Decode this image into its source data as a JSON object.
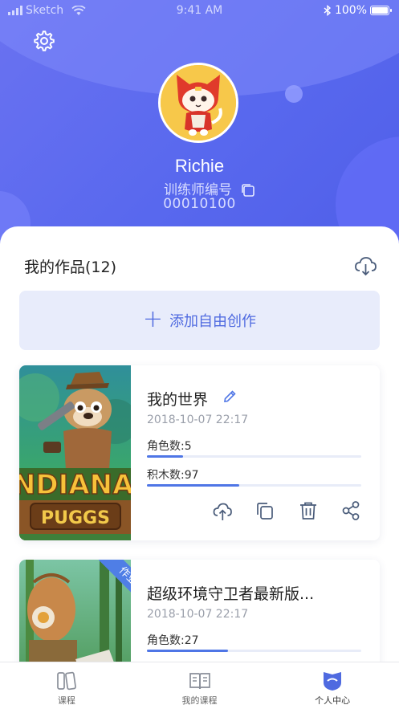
{
  "status_bar": {
    "carrier": "Sketch",
    "time": "9:41 AM",
    "battery": "100%"
  },
  "profile": {
    "username": "Richie",
    "trainer_label": "训练师编号",
    "trainer_id": "00010100"
  },
  "works": {
    "title": "我的作品(12)",
    "add_label": "添加自由创作",
    "items": [
      {
        "title": "我的世界",
        "date": "2018-10-07 22:17",
        "roles_label": "角色数:5",
        "roles_fill": 0.17,
        "blocks_label": "积木数:97",
        "blocks_fill": 0.43,
        "thumb_text": "NDIANA",
        "thumb_sub": "PUGGS"
      },
      {
        "title": "超级环境守卫者最新版...",
        "date": "2018-10-07 22:17",
        "roles_label": "角色数:27",
        "roles_fill": 0.38,
        "badge": "作业"
      }
    ]
  },
  "tabbar": {
    "tabs": [
      {
        "label": "课程",
        "icon": "books-icon"
      },
      {
        "label": "我的课程",
        "icon": "open-book-icon"
      },
      {
        "label": "个人中心",
        "icon": "profile-shield-icon"
      }
    ]
  },
  "colors": {
    "primary": "#5868ee",
    "accent": "#4f76e6",
    "add_button_bg": "#e8ecfb"
  }
}
